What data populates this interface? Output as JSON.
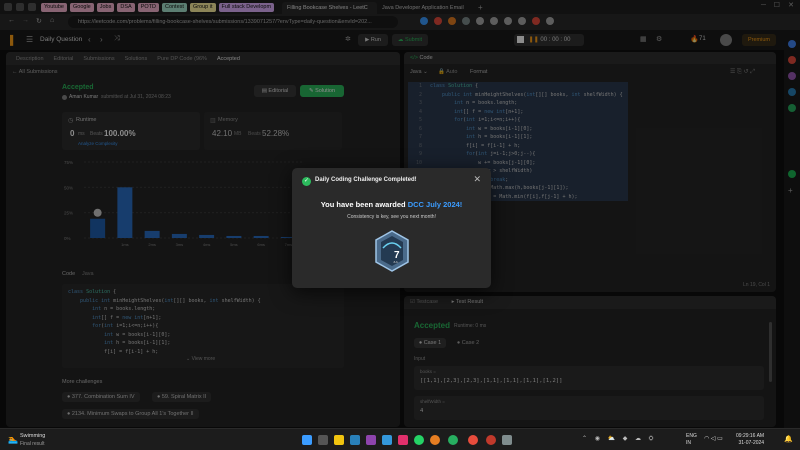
{
  "browser": {
    "bookmarks": [
      {
        "label": "Youtube",
        "color": "#f7b6d2"
      },
      {
        "label": "Google",
        "color": "#f7b6d2"
      },
      {
        "label": "Jobs",
        "color": "#f7b6d2"
      },
      {
        "label": "DSA",
        "color": "#f7b6d2"
      },
      {
        "label": "POTD",
        "color": "#f7b6d2"
      },
      {
        "label": "Contest",
        "color": "#a8e6cf"
      },
      {
        "label": "Group it",
        "color": "#fff3a0"
      },
      {
        "label": "Full stack Developm",
        "color": "#e0b3ff"
      }
    ],
    "tabs": [
      {
        "label": "Filling Bookcase Shelves - LeetC",
        "active": true
      },
      {
        "label": "Java Developer Application Email",
        "active": false
      }
    ],
    "url": "https://leetcode.com/problems/filling-bookcase-shelves/submissions/1339071257/?envType=daily-question&envId=202..."
  },
  "header": {
    "daily_question": "Daily Question",
    "run": "Run",
    "submit": "Submit",
    "timer": "00 : 00 : 00",
    "streak": "71",
    "premium": "Premium"
  },
  "left": {
    "tabs": [
      "Description",
      "Editorial",
      "Submissions",
      "Solutions",
      "Pure DP Code (96%",
      "Accepted"
    ],
    "all_submissions": "All Submissions",
    "status": "Accepted",
    "author": "Aman Kumar",
    "submitted_at": "submitted at Jul 31, 2024 08:23",
    "editorial_btn": "Editorial",
    "solution_btn": "Solution",
    "runtime_label": "Runtime",
    "runtime_value": "0",
    "runtime_unit": "ms",
    "beats_label": "Beats",
    "beats_value": "100.00%",
    "analyze": "Analyze Complexity",
    "memory_label": "Memory",
    "memory_value": "42.10",
    "memory_unit": "MB",
    "memory_beats_label": "Beats",
    "memory_beats_value": "52.28%",
    "y_ticks": [
      "75%",
      "50%",
      "25%",
      "0%"
    ],
    "code_header": "Code",
    "code_lang": "Java",
    "view_more": "View more",
    "more_challenges": "More challenges",
    "challenges": [
      "377. Combination Sum IV",
      "59. Spiral Matrix II",
      "2134. Minimum Swaps to Group All 1's Together II"
    ]
  },
  "chart_data": {
    "type": "bar",
    "categories": [
      "",
      "1ms",
      "2ms",
      "3ms",
      "4ms",
      "5ms",
      "6ms",
      "7ms"
    ],
    "values": [
      19,
      50,
      7,
      4,
      3,
      2,
      2,
      1
    ],
    "ylim": [
      0,
      75
    ],
    "highlight_index": 0
  },
  "code": {
    "lines": [
      [
        [
          "kw",
          "class "
        ],
        [
          "ty",
          "Solution "
        ],
        [
          "tx",
          "{"
        ]
      ],
      [
        [
          "tx",
          "    "
        ],
        [
          "kw",
          "public int "
        ],
        [
          "tx",
          "minHeightShelves("
        ],
        [
          "kw",
          "int"
        ],
        [
          "tx",
          "[][] books, "
        ],
        [
          "kw",
          "int "
        ],
        [
          "tx",
          "shelfWidth) {"
        ]
      ],
      [
        [
          "tx",
          "        "
        ],
        [
          "kw",
          "int "
        ],
        [
          "tx",
          "n = books.length;"
        ]
      ],
      [
        [
          "tx",
          "        "
        ],
        [
          "kw",
          "int"
        ],
        [
          "tx",
          "[] f = "
        ],
        [
          "kw",
          "new int"
        ],
        [
          "tx",
          "[n+1];"
        ]
      ],
      [
        [
          "tx",
          "        "
        ],
        [
          "kw",
          "for"
        ],
        [
          "tx",
          "("
        ],
        [
          "kw",
          "int "
        ],
        [
          "tx",
          "i=1;i<=n;i++){"
        ]
      ],
      [
        [
          "tx",
          "            "
        ],
        [
          "kw",
          "int "
        ],
        [
          "tx",
          "w = books[i-1][0];"
        ]
      ],
      [
        [
          "tx",
          "            "
        ],
        [
          "kw",
          "int "
        ],
        [
          "tx",
          "h = books[i-1][1];"
        ]
      ],
      [
        [
          "tx",
          "            f[i] = f[i-1] + h;"
        ]
      ],
      [
        [
          "tx",
          "            "
        ],
        [
          "kw",
          "for"
        ],
        [
          "tx",
          "("
        ],
        [
          "kw",
          "int "
        ],
        [
          "tx",
          "j=i-1;j>0;j--){"
        ]
      ],
      [
        [
          "tx",
          "                w += books[j-1][0];"
        ]
      ],
      [
        [
          "tx",
          "                "
        ],
        [
          "kw",
          "if"
        ],
        [
          "tx",
          "(w > shelfWidth)"
        ]
      ],
      [
        [
          "tx",
          "                    "
        ],
        [
          "kw",
          "break"
        ],
        [
          "tx",
          ";"
        ]
      ],
      [
        [
          "tx",
          "                h = Math.max(h,books[j-1][1]);"
        ]
      ],
      [
        [
          "tx",
          "                f[i] = Math.min(f[i],f[j-1] + h);"
        ]
      ]
    ],
    "short_lines": [
      [
        [
          "kw",
          "class "
        ],
        [
          "ty",
          "Solution "
        ],
        [
          "tx",
          "{"
        ]
      ],
      [
        [
          "tx",
          "    "
        ],
        [
          "kw",
          "public int "
        ],
        [
          "tx",
          "minHeightShelves("
        ],
        [
          "kw",
          "int"
        ],
        [
          "tx",
          "[][] books, "
        ],
        [
          "kw",
          "int "
        ],
        [
          "tx",
          "shelfWidth) {"
        ]
      ],
      [
        [
          "tx",
          "        "
        ],
        [
          "kw",
          "int "
        ],
        [
          "tx",
          "n = books.length;"
        ]
      ],
      [
        [
          "tx",
          "        "
        ],
        [
          "kw",
          "int"
        ],
        [
          "tx",
          "[] f = "
        ],
        [
          "kw",
          "new int"
        ],
        [
          "tx",
          "[n+1];"
        ]
      ],
      [
        [
          "tx",
          "        "
        ],
        [
          "kw",
          "for"
        ],
        [
          "tx",
          "("
        ],
        [
          "kw",
          "int "
        ],
        [
          "tx",
          "i=1;i<=n;i++){"
        ]
      ],
      [
        [
          "tx",
          "            "
        ],
        [
          "kw",
          "int "
        ],
        [
          "tx",
          "w = books[i-1][0];"
        ]
      ],
      [
        [
          "tx",
          "            "
        ],
        [
          "kw",
          "int "
        ],
        [
          "tx",
          "h = books[i-1][1];"
        ]
      ],
      [
        [
          "tx",
          "            f[i] = f[i-1] + h;"
        ]
      ]
    ]
  },
  "right": {
    "code_title": "Code",
    "lang": "Java",
    "auto": "Auto",
    "format": "Format",
    "cursor": "Ln 19, Col 1",
    "testcase": "Testcase",
    "test_result": "Test Result",
    "result_status": "Accepted",
    "result_runtime": "Runtime: 0 ms",
    "case1": "Case 1",
    "case2": "Case 2",
    "input_label": "Input",
    "books_label": "books =",
    "books_value": "[[1,1],[2,3],[2,3],[1,1],[1,1],[1,1],[1,2]]",
    "shelf_label": "shelfWidth =",
    "shelf_value": "4"
  },
  "modal": {
    "title": "Daily Coding Challenge Completed!",
    "award_prefix": "You have been awarded ",
    "award_badge": "DCC July 2024!",
    "subtitle": "Consistency is key, see you next month!",
    "badge_number": "7",
    "badge_sub": "JUL"
  },
  "taskbar": {
    "weather_title": "Swimming",
    "weather_sub": "Final result",
    "lang1": "ENG",
    "lang2": "IN",
    "time": "09:29:16 AM",
    "date": "31-07-2024"
  },
  "colors": {
    "accent": "#2cbb5d",
    "link": "#3b9cff",
    "gold": "#ffa116"
  }
}
